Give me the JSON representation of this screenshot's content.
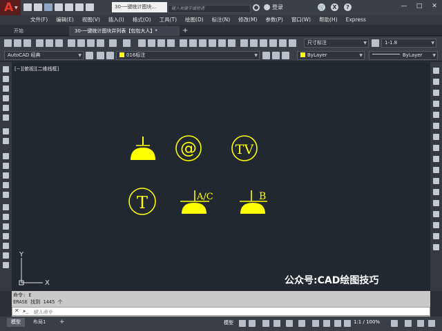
{
  "window": {
    "title": "30-一键统计图块...",
    "search_placeholder": "键入关键字或短语",
    "login_label": "登录",
    "controls": [
      "—",
      "□",
      "✕"
    ]
  },
  "menu": [
    "文件(F)",
    "编辑(E)",
    "视图(V)",
    "插入(I)",
    "格式(O)",
    "工具(T)",
    "绘图(D)",
    "标注(N)",
    "修改(M)",
    "参数(P)",
    "窗口(W)",
    "帮助(H)",
    "Express"
  ],
  "tabs": {
    "start": "开始",
    "drawing": "30-一键统计图块并列表【包包大人】*",
    "add": "+"
  },
  "toolbar": {
    "workspace": "AutoCAD 经典",
    "layer": "016标注",
    "dim_style": "尺寸标注",
    "scale": "1-1.8",
    "color": "ByLayer",
    "linetype": "ByLayer",
    "layer_color": "#ffff00"
  },
  "canvas": {
    "view_label": "[−][俯视][二维线框]",
    "axis_x": "X",
    "axis_y": "Y",
    "symbol_color": "#ffff00",
    "symbols": {
      "at_symbol": "@",
      "tv_symbol": "TV",
      "t_symbol": "T",
      "ac_label": "A/C",
      "b_label": "B"
    },
    "watermark": "公众号:CAD绘图技巧"
  },
  "command": {
    "line1": "命令: E",
    "line2": "ERASE 找到 1445 个",
    "placeholder": "键入命令",
    "close": "✕"
  },
  "statusbar": {
    "tabs": [
      "模型",
      "布局1",
      "+"
    ],
    "model_label": "模型",
    "scale": "1:1 / 100%"
  }
}
